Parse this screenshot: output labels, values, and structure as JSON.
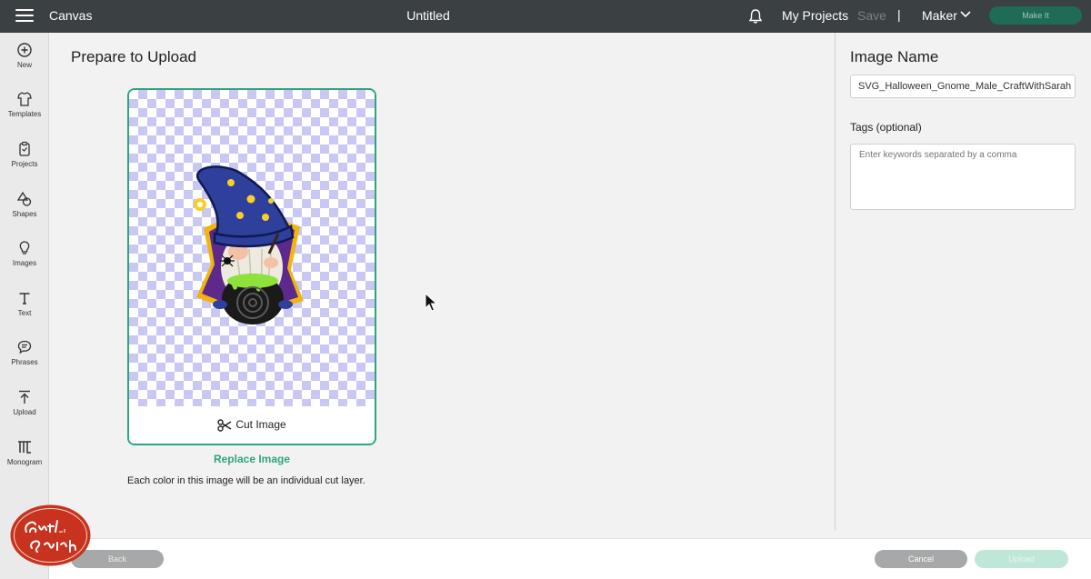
{
  "topbar": {
    "app_name": "Canvas",
    "doc_title": "Untitled",
    "my_projects": "My Projects",
    "save": "Save",
    "separator": "|",
    "machine": "Maker",
    "make_it": "Make It"
  },
  "sidebar": {
    "items": [
      {
        "label": "New",
        "icon": "plus-circle-icon"
      },
      {
        "label": "Templates",
        "icon": "shirt-icon"
      },
      {
        "label": "Projects",
        "icon": "clipboard-icon"
      },
      {
        "label": "Shapes",
        "icon": "shapes-icon"
      },
      {
        "label": "Images",
        "icon": "lightbulb-icon"
      },
      {
        "label": "Text",
        "icon": "text-icon"
      },
      {
        "label": "Phrases",
        "icon": "speech-bubble-icon"
      },
      {
        "label": "Upload",
        "icon": "upload-icon"
      },
      {
        "label": "Monogram",
        "icon": "monogram-icon"
      }
    ]
  },
  "main": {
    "title": "Prepare to Upload",
    "cut_image": "Cut Image",
    "replace_image": "Replace Image",
    "info": "Each color in this image will be an individual cut layer."
  },
  "right_panel": {
    "title": "Image Name",
    "image_name_value": "SVG_Halloween_Gnome_Male_CraftWithSarah",
    "tags_label": "Tags (optional)",
    "tags_placeholder": "Enter keywords separated by a comma"
  },
  "footer": {
    "back": "Back",
    "cancel": "Cancel",
    "upload": "Upload"
  },
  "watermark": {
    "text": "Craft with Sarah"
  },
  "colors": {
    "accent_green": "#2fa57c",
    "topbar": "#3b4042",
    "make_it_button": "#1f6b55",
    "checker": "#c9c8f5"
  }
}
